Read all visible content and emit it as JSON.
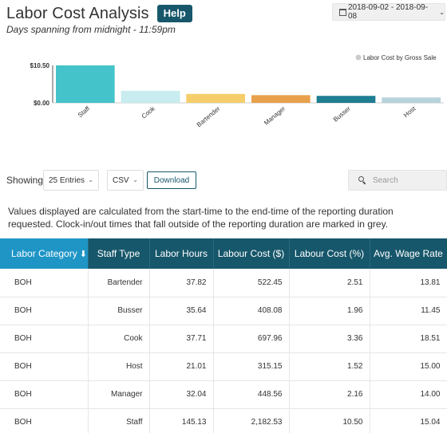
{
  "header": {
    "title": "Labor Cost Analysis",
    "help_label": "Help",
    "subtitle": "Days spanning from midnight - 11:59pm",
    "date_range": "2018-09-02 - 2018-09-08"
  },
  "chart_data": {
    "type": "bar",
    "categories": [
      "Staff",
      "Cook",
      "Bartender",
      "Manager",
      "Busser",
      "Host"
    ],
    "values": [
      10.5,
      3.36,
      2.51,
      2.16,
      1.96,
      1.52
    ],
    "colors": [
      "#44c3cb",
      "#c8ecef",
      "#f5cd6b",
      "#e9a04b",
      "#1e7e92",
      "#b7d3dc"
    ],
    "ytick_labels": [
      "$10.50",
      "$0.00"
    ],
    "ylim": [
      0,
      10.5
    ],
    "legend": {
      "label": "Labor Cost by Gross Sale",
      "placement": "top-right"
    },
    "grid": false
  },
  "toolbar": {
    "showing_label": "Showing",
    "entries_value": "25 Entries",
    "format_value": "CSV",
    "download_label": "Download",
    "search_placeholder": "Search"
  },
  "info_text": "Values displayed are calculated from the start-time to the end-time of the reporting duration requested. Clock-in/out times that fall outside of the reporting duration are marked in grey.",
  "table": {
    "headers": [
      "Labor Category",
      "Staff Type",
      "Labor Hours",
      "Labour Cost ($)",
      "Labour Cost (%)",
      "Avg. Wage Rate"
    ],
    "sort_arrow": "⬇",
    "rows": [
      [
        "BOH",
        "Bartender",
        "37.82",
        "522.45",
        "2.51",
        "13.81"
      ],
      [
        "BOH",
        "Busser",
        "35.64",
        "408.08",
        "1.96",
        "11.45"
      ],
      [
        "BOH",
        "Cook",
        "37.71",
        "697.96",
        "3.36",
        "18.51"
      ],
      [
        "BOH",
        "Host",
        "21.01",
        "315.15",
        "1.52",
        "15.00"
      ],
      [
        "BOH",
        "Manager",
        "32.04",
        "448.56",
        "2.16",
        "14.00"
      ],
      [
        "BOH",
        "Staff",
        "145.13",
        "2,182.53",
        "10.50",
        "15.04"
      ]
    ]
  },
  "colors": {
    "brand_dark": "#17576b",
    "header_active": "#1f95c6",
    "panel_bg": "#f0f0f0"
  }
}
